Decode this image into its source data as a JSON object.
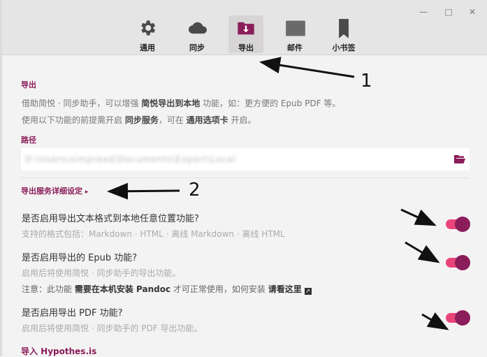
{
  "tabs": [
    {
      "label": "通用",
      "icon": "gear-icon"
    },
    {
      "label": "同步",
      "icon": "cloud-icon"
    },
    {
      "label": "导出",
      "icon": "folder-export-icon",
      "active": true
    },
    {
      "label": "邮件",
      "icon": "mail-icon"
    },
    {
      "label": "小书签",
      "icon": "bookmark-icon"
    }
  ],
  "export": {
    "title": "导出",
    "desc1": {
      "pre": "借助简悦 · 同步助手，可以增强 ",
      "bold": "简悦导出到本地",
      "post": " 功能，如：更方便的 Epub PDF 等。"
    },
    "desc2": {
      "pre": "使用以下功能的前提需开启 ",
      "bold1": "同步服务",
      "mid": "，可在 ",
      "bold2": "通用选项卡",
      "post": " 开启。"
    }
  },
  "path": {
    "title": "路径",
    "value": "D:\\Users\\simpread\\Documents\\Export\\Local"
  },
  "service_link": "导出服务详细设定",
  "options": [
    {
      "question": "是否启用导出文本格式到本地任意位置功能?",
      "hint": "支持的格式包括：Markdown · HTML · 离线 Markdown · 离线 HTML",
      "on": true
    },
    {
      "question": "是否启用导出的 Epub 功能?",
      "hint": "启用后将使用简悦 · 同步助手的导出功能。",
      "note": {
        "pre": "注意：此功能 ",
        "bold": "需要在本机安装 Pandoc",
        "mid": " 才可正常使用，如何安装 ",
        "link": "请看这里"
      },
      "on": true
    },
    {
      "question": "是否启用导出 PDF 功能?",
      "hint": "启用后将使用简悦 · 同步助手的 PDF 导出功能。",
      "on": true
    }
  ],
  "import_title": "导入 Hypothes.is",
  "annotations": [
    "1",
    "2"
  ],
  "colors": {
    "accent": "#8a1d5a",
    "toggle_track": "#e9457a",
    "header_bg": "#e6e5e5",
    "page_bg": "#f4f3f3"
  }
}
